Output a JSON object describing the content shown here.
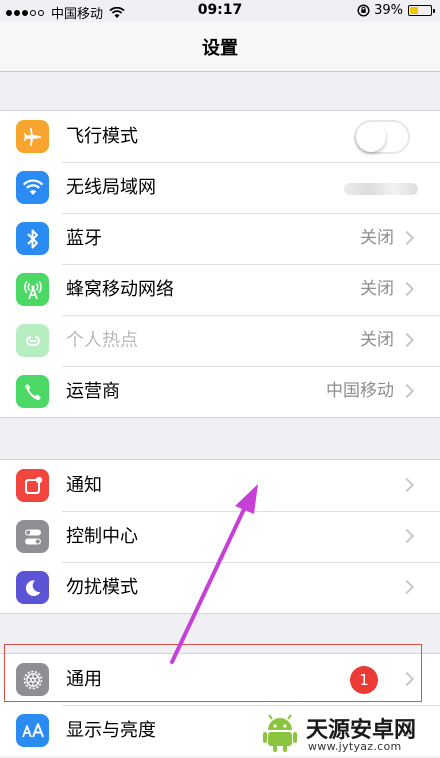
{
  "status_bar": {
    "carrier": "中国移动",
    "time": "09:17",
    "battery": "39%",
    "battery_level": 0.39
  },
  "nav": {
    "title": "设置"
  },
  "group1": [
    {
      "label": "飞行模式",
      "icon": "airplane-icon",
      "color": "#f7a52f",
      "toggle": false
    },
    {
      "label": "无线局域网",
      "icon": "wifi-icon",
      "color": "#2a8bf2"
    },
    {
      "label": "蓝牙",
      "icon": "bluetooth-icon",
      "color": "#2a8bf2",
      "value": "关闭"
    },
    {
      "label": "蜂窝移动网络",
      "icon": "cellular-icon",
      "color": "#4cd864",
      "value": "关闭"
    },
    {
      "label": "个人热点",
      "icon": "hotspot-icon",
      "color": "#b6eec2",
      "value": "关闭"
    },
    {
      "label": "运营商",
      "icon": "phone-icon",
      "color": "#4cd864",
      "value": "中国移动"
    }
  ],
  "group2": [
    {
      "label": "通知",
      "icon": "notification-icon",
      "color": "#f2453d"
    },
    {
      "label": "控制中心",
      "icon": "control-center-icon",
      "color": "#8e8e93"
    },
    {
      "label": "勿扰模式",
      "icon": "moon-icon",
      "color": "#5b55d6"
    }
  ],
  "group3": [
    {
      "label": "通用",
      "icon": "gear-icon",
      "color": "#8e8e93",
      "badge": "1"
    },
    {
      "label": "显示与亮度",
      "icon": "text-size-icon",
      "color": "#2a8bf2"
    }
  ],
  "watermark": {
    "title": "天源安卓网",
    "url": "www.jytyaz.com"
  }
}
